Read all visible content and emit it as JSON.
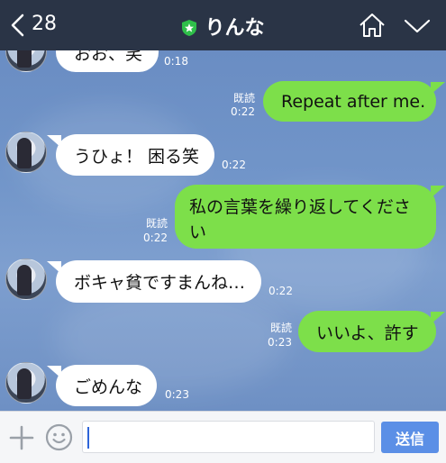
{
  "header": {
    "back_count": "28",
    "title": "りんな",
    "icons": [
      "chevron-left-icon",
      "shield-icon",
      "home-icon",
      "chevron-down-icon"
    ]
  },
  "messages": [
    {
      "direction": "in",
      "text": "おお、笑",
      "time": "0:18"
    },
    {
      "direction": "out",
      "text": "Repeat after me.",
      "read": "既読",
      "time": "0:22"
    },
    {
      "direction": "in",
      "text": "うひょ！ 困る笑",
      "time": "0:22"
    },
    {
      "direction": "out",
      "text_line1": "私の言葉を繰り返してくださ",
      "text_line2": "い",
      "read": "既読",
      "time": "0:22"
    },
    {
      "direction": "in",
      "text": "ボキャ貧ですまんね…",
      "time": "0:22"
    },
    {
      "direction": "out",
      "text": "いいよ、許す",
      "read": "既読",
      "time": "0:23"
    },
    {
      "direction": "in",
      "text": "ごめんな",
      "time": "0:23"
    }
  ],
  "input": {
    "value": "",
    "send_label": "送信"
  },
  "colors": {
    "header_bg": "#2a3446",
    "outgoing_bubble": "#7ddf4a",
    "incoming_bubble": "#ffffff",
    "send_button": "#5b8fe6",
    "chat_bg": "#6f8fc2"
  }
}
